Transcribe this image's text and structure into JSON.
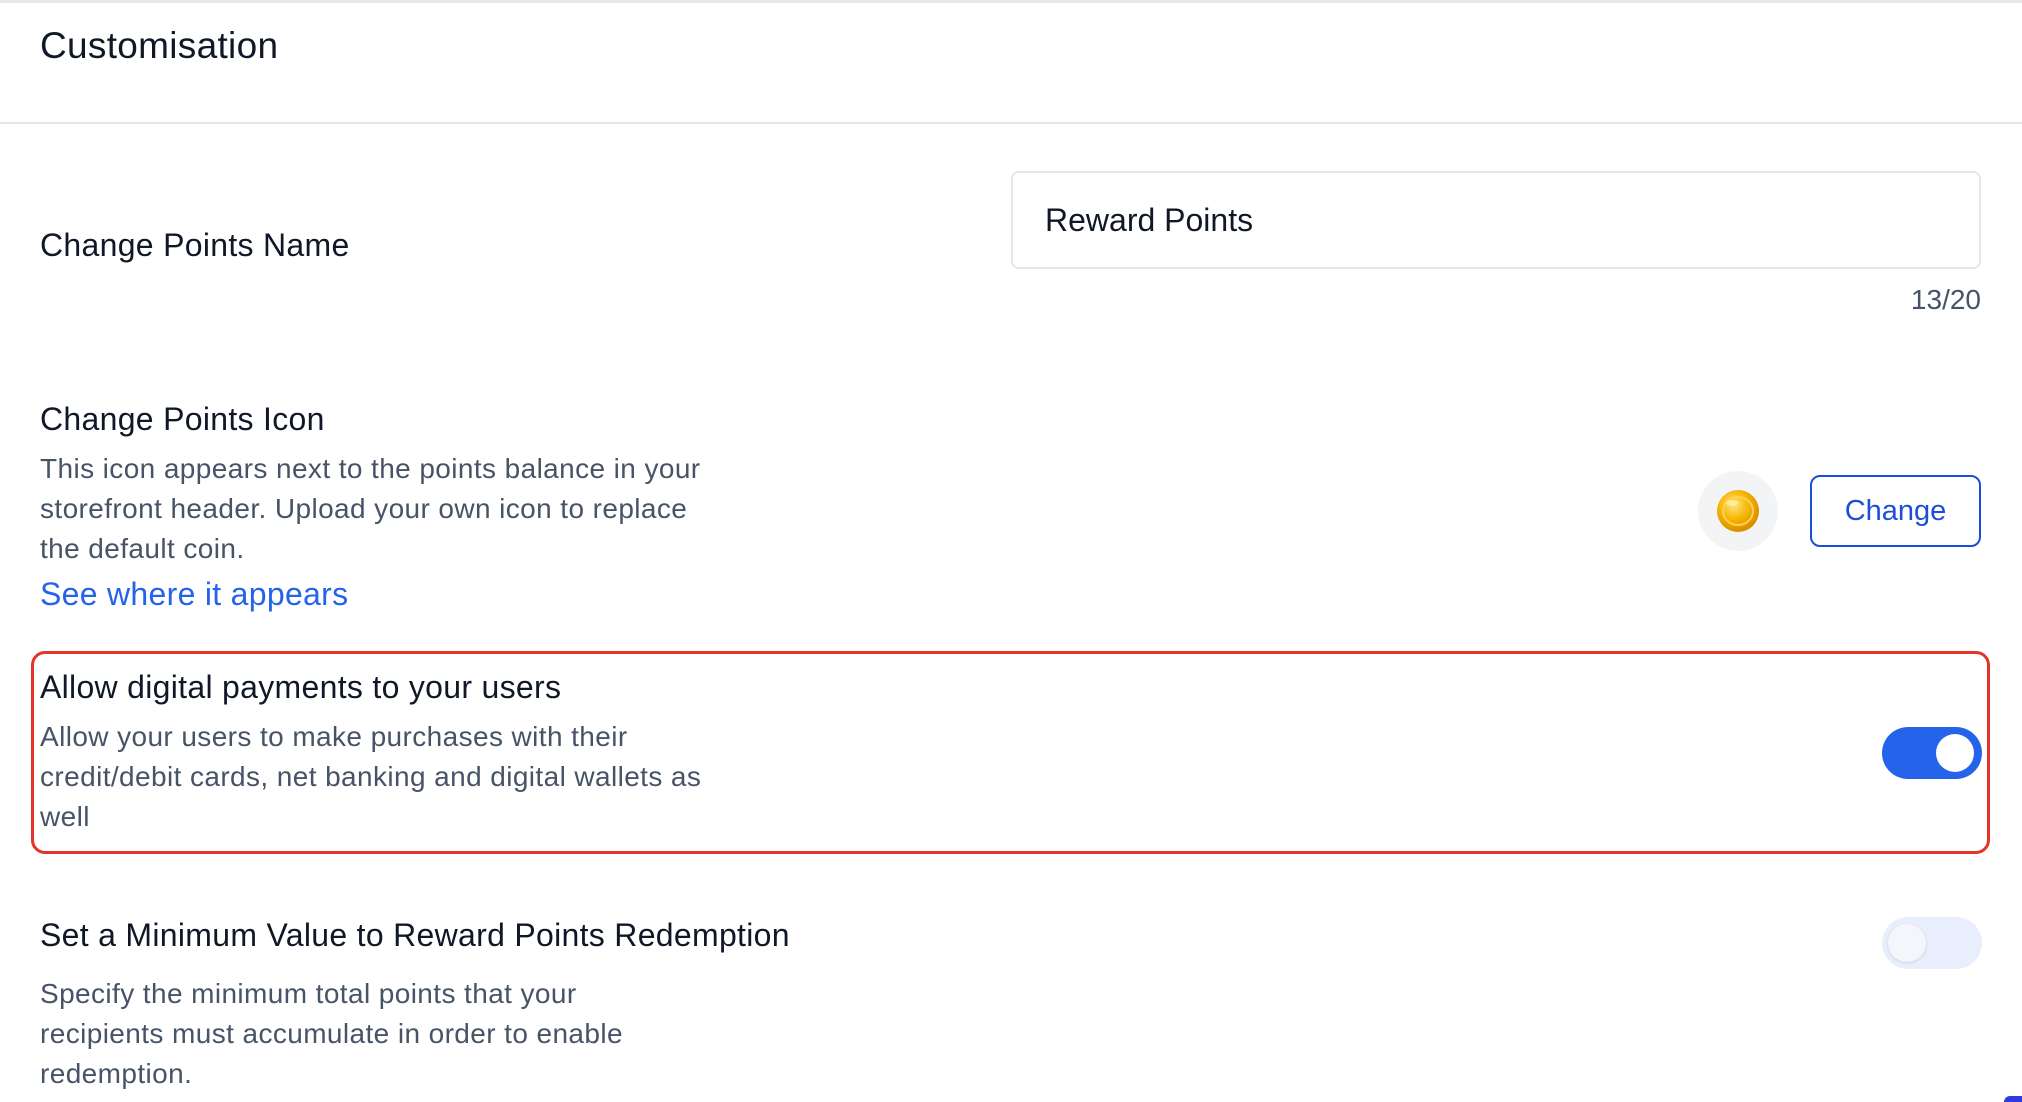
{
  "header": {
    "title": "Customisation"
  },
  "points_name": {
    "label": "Change Points Name",
    "value": "Reward Points",
    "counter": "13/20"
  },
  "points_icon": {
    "label": "Change Points Icon",
    "description_lines": [
      "This icon appears next to the points balance in your",
      "storefront header. Upload your own icon to replace",
      "the default coin."
    ],
    "link_text": "See where it appears",
    "icon": "gold-coin-icon",
    "change_label": "Change"
  },
  "digital_payments": {
    "label": "Allow digital payments to your users",
    "description_lines": [
      "Allow your users to make purchases with their",
      "credit/debit cards, net banking and digital wallets as",
      "well"
    ],
    "enabled": true
  },
  "min_redemption": {
    "label": "Set a Minimum Value to Reward Points Redemption",
    "description_lines": [
      "Specify the minimum total points that your",
      "recipients must accumulate in order to enable",
      "redemption."
    ],
    "enabled": false
  },
  "colors": {
    "accent": "#2563eb",
    "highlight": "#e5352b",
    "coin": "#f5b400"
  }
}
